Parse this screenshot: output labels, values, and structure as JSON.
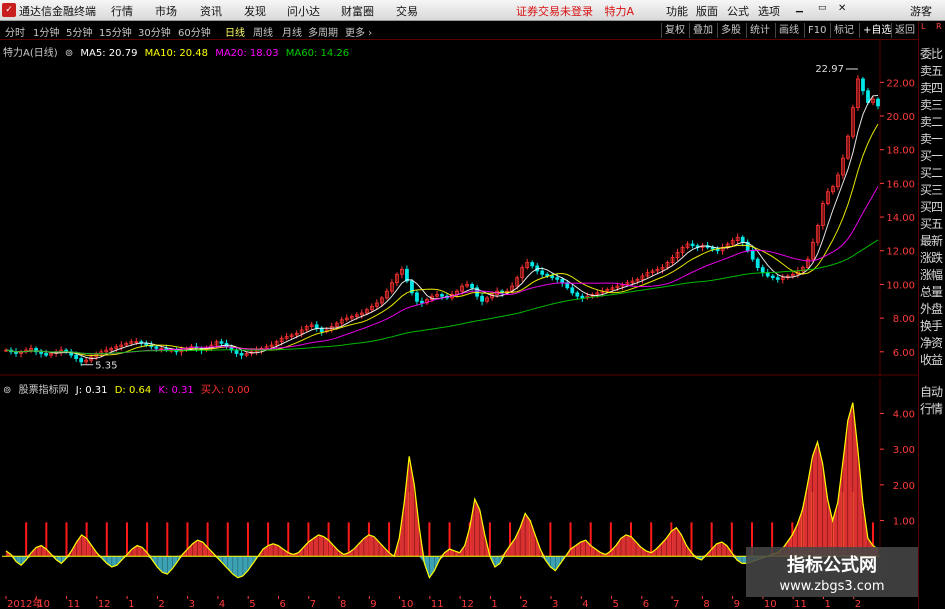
{
  "app": {
    "title": "通达信金融终端",
    "menu": [
      "行情",
      "市场",
      "资讯",
      "发现",
      "问小达",
      "财富圈",
      "交易"
    ],
    "login_notice": "证券交易未登录",
    "stock_name": "特力A",
    "right_menu": [
      "功能",
      "版面",
      "公式",
      "选项"
    ],
    "guest": "游客"
  },
  "toolbar": {
    "periods": [
      "分时",
      "1分钟",
      "5分钟",
      "15分钟",
      "30分钟",
      "60分钟",
      "日线",
      "周线",
      "月线",
      "多周期",
      "更多"
    ],
    "active_period": "日线",
    "tools": [
      "复权",
      "叠加",
      "多股",
      "统计",
      "画线",
      "F10",
      "标记"
    ],
    "auto_select": "+自选",
    "back": "返回"
  },
  "main_legend": {
    "title": "特力A(日线)",
    "ma5": "MA5: 20.79",
    "ma10": "MA10: 20.48",
    "ma20": "MA20: 18.03",
    "ma60": "MA60: 14.26"
  },
  "sub_legend": {
    "title": "股票指标网",
    "j": "J: 0.31",
    "d": "D: 0.64",
    "k": "K: 0.31",
    "buy": "买入: 0.00"
  },
  "side_panel": {
    "labels": [
      "委比",
      "卖五",
      "卖四",
      "卖三",
      "卖二",
      "卖一",
      "买一",
      "买二",
      "买三",
      "买四",
      "买五",
      "最新",
      "涨跌",
      "涨幅",
      "总量",
      "外盘",
      "换手",
      "净资",
      "收益"
    ],
    "bottom": [
      "自动",
      "行情"
    ],
    "corner_top": "L",
    "corner_bottom": "R"
  },
  "watermark": {
    "line1": "指标公式网",
    "line2": "www.zbgs3.com"
  },
  "colors": {
    "up": "#ff3232",
    "down": "#00e6e6",
    "ma5": "#ffffff",
    "ma10": "#ffff00",
    "ma20": "#ff00ff",
    "ma60": "#00cc00",
    "axis_text": "#ff3c3c",
    "grid": "#5a0000",
    "kdj_pos": "#ff3a3a",
    "kdj_neg": "#43b3c6",
    "signal_red": "#ff1a1a",
    "signal_yellow": "#ffff00"
  },
  "chart_data": [
    {
      "type": "candlestick",
      "title": "特力A(日线)",
      "ylim": [
        4.8,
        23.8
      ],
      "yticks": [
        6.0,
        8.0,
        10.0,
        12.0,
        14.0,
        16.0,
        18.0,
        20.0,
        22.0
      ],
      "annotations": [
        {
          "label": "22.97",
          "value": 22.97
        },
        {
          "label": "5.35",
          "value": 5.35
        }
      ],
      "closes": [
        6.1,
        6.0,
        5.9,
        6.0,
        6.1,
        6.2,
        6.0,
        5.9,
        5.8,
        5.9,
        6.0,
        6.1,
        6.0,
        5.8,
        5.6,
        5.4,
        5.5,
        5.7,
        5.9,
        6.0,
        6.1,
        6.2,
        6.3,
        6.4,
        6.5,
        6.6,
        6.6,
        6.5,
        6.4,
        6.3,
        6.2,
        6.2,
        6.1,
        6.1,
        6.0,
        6.1,
        6.2,
        6.3,
        6.2,
        6.1,
        6.2,
        6.4,
        6.6,
        6.5,
        6.3,
        6.1,
        5.9,
        5.8,
        5.9,
        6.0,
        6.1,
        6.2,
        6.3,
        6.4,
        6.6,
        6.8,
        6.9,
        7.0,
        7.1,
        7.3,
        7.5,
        7.6,
        7.4,
        7.2,
        7.3,
        7.5,
        7.7,
        7.9,
        8.0,
        8.1,
        8.2,
        8.3,
        8.5,
        8.7,
        8.9,
        9.2,
        9.6,
        10.1,
        10.6,
        10.9,
        10.2,
        9.5,
        9.0,
        8.9,
        9.1,
        9.3,
        9.4,
        9.3,
        9.2,
        9.4,
        9.6,
        9.9,
        10.0,
        9.8,
        9.3,
        9.0,
        9.2,
        9.4,
        9.6,
        9.5,
        9.6,
        9.9,
        10.4,
        11.0,
        11.3,
        11.1,
        10.8,
        10.6,
        10.5,
        10.4,
        10.3,
        10.1,
        9.8,
        9.5,
        9.3,
        9.2,
        9.3,
        9.4,
        9.5,
        9.6,
        9.7,
        9.8,
        9.9,
        10.0,
        10.1,
        10.2,
        10.3,
        10.5,
        10.7,
        10.8,
        10.9,
        11.0,
        11.3,
        11.6,
        11.9,
        12.2,
        12.4,
        12.3,
        12.2,
        12.3,
        12.2,
        12.1,
        12.0,
        12.2,
        12.4,
        12.6,
        12.8,
        12.5,
        12.0,
        11.5,
        11.0,
        10.7,
        10.5,
        10.4,
        10.3,
        10.4,
        10.5,
        10.6,
        10.8,
        11.0,
        11.5,
        12.5,
        13.5,
        14.8,
        15.5,
        15.8,
        16.5,
        17.5,
        18.8,
        20.5,
        22.2,
        21.5,
        20.8,
        21.0,
        20.6
      ]
    },
    {
      "type": "bar",
      "title": "股票指标网",
      "ylim": [
        -1.0,
        4.6
      ],
      "yticks": [
        1.0,
        2.0,
        3.0,
        4.0
      ],
      "x_tick_labels": [
        "2012年",
        "10",
        "11",
        "12",
        "1",
        "2",
        "3",
        "4",
        "5",
        "6",
        "7",
        "8",
        "9",
        "10",
        "11",
        "12",
        "1",
        "2",
        "3",
        "4",
        "5",
        "6",
        "7",
        "8",
        "9",
        "10",
        "11",
        "1",
        "2"
      ],
      "k_curve": [
        0.15,
        0.05,
        -0.15,
        -0.25,
        -0.1,
        0.1,
        0.25,
        0.3,
        0.2,
        0.05,
        -0.1,
        -0.2,
        -0.05,
        0.15,
        0.4,
        0.6,
        0.5,
        0.3,
        0.1,
        -0.05,
        -0.2,
        -0.3,
        -0.25,
        -0.1,
        0.05,
        0.2,
        0.3,
        0.25,
        0.1,
        -0.1,
        -0.3,
        -0.45,
        -0.5,
        -0.35,
        -0.15,
        0.05,
        0.2,
        0.35,
        0.45,
        0.4,
        0.25,
        0.1,
        -0.05,
        -0.2,
        -0.35,
        -0.5,
        -0.6,
        -0.55,
        -0.4,
        -0.2,
        0.0,
        0.2,
        0.3,
        0.35,
        0.3,
        0.2,
        0.1,
        0.05,
        0.1,
        0.25,
        0.4,
        0.5,
        0.6,
        0.55,
        0.45,
        0.3,
        0.15,
        0.05,
        0.1,
        0.2,
        0.35,
        0.5,
        0.6,
        0.55,
        0.4,
        0.25,
        0.1,
        0.0,
        0.5,
        1.5,
        2.8,
        2.0,
        0.8,
        -0.2,
        -0.6,
        -0.4,
        -0.1,
        0.1,
        0.2,
        0.15,
        0.1,
        0.3,
        0.8,
        1.6,
        1.3,
        0.6,
        0.0,
        -0.3,
        -0.2,
        0.1,
        0.3,
        0.5,
        0.8,
        1.2,
        1.0,
        0.6,
        0.2,
        -0.1,
        -0.3,
        -0.4,
        -0.2,
        0.0,
        0.2,
        0.3,
        0.4,
        0.45,
        0.3,
        0.2,
        0.1,
        0.05,
        0.15,
        0.3,
        0.5,
        0.6,
        0.55,
        0.4,
        0.25,
        0.15,
        0.1,
        0.2,
        0.35,
        0.5,
        0.7,
        0.8,
        0.6,
        0.3,
        0.1,
        -0.05,
        -0.1,
        0.05,
        0.2,
        0.35,
        0.4,
        0.3,
        0.1,
        -0.1,
        -0.2,
        -0.2,
        -0.15,
        -0.1,
        -0.05,
        0.0,
        0.05,
        0.1,
        0.2,
        0.4,
        0.6,
        0.9,
        1.3,
        2.0,
        2.8,
        3.2,
        2.6,
        1.6,
        1.0,
        1.5,
        2.6,
        3.8,
        4.3,
        3.0,
        1.5,
        0.5,
        0.3,
        0.2
      ]
    }
  ]
}
